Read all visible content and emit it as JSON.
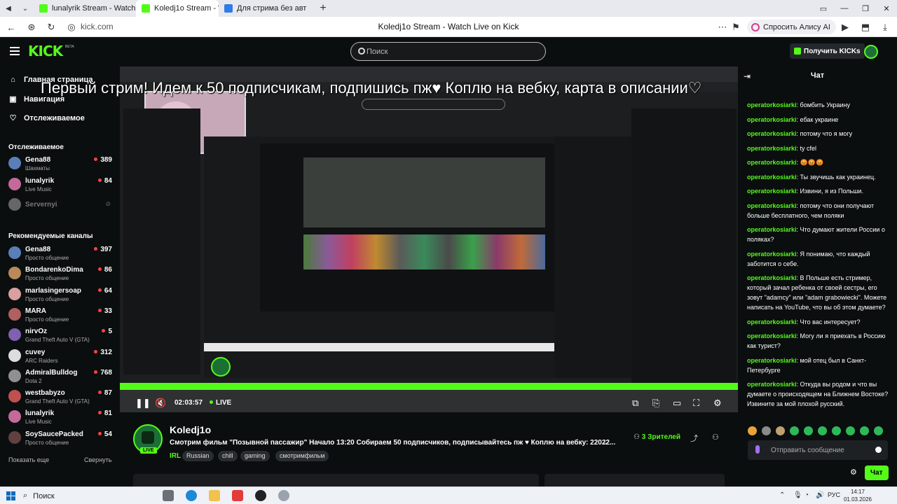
{
  "browser": {
    "tabs": [
      {
        "title": "lunalyrik Stream - Watch L",
        "active": false
      },
      {
        "title": "Koledj1o Stream - Watc",
        "active": true
      },
      {
        "title": "Для стрима без авт",
        "active": false
      }
    ],
    "url": "kick.com",
    "page_title": "Koledj1o Stream - Watch Live on Kick",
    "alice_label": "Спросить Алису AI"
  },
  "header": {
    "logo": "KICK",
    "beta": "BETA",
    "search_placeholder": "Поиск",
    "get_kicks_label": "Получить KICKs"
  },
  "sidebar": {
    "nav": [
      {
        "label": "Главная страница",
        "icon": "home-icon"
      },
      {
        "label": "Навигация",
        "icon": "compass-icon"
      },
      {
        "label": "Отслеживаемое",
        "icon": "heart-icon"
      }
    ],
    "following_header": "Отслеживаемое",
    "following": [
      {
        "name": "Gena88",
        "sub": "Шахматы",
        "viewers": "389",
        "color": "#5a7fb8"
      },
      {
        "name": "lunalyrik",
        "sub": "Live Music",
        "viewers": "84",
        "color": "#c46a9a"
      },
      {
        "name": "Servernyi",
        "sub": "",
        "viewers": "",
        "color": "#666666",
        "offline": true
      }
    ],
    "recommended_header": "Рекомендуемые каналы",
    "recommended": [
      {
        "name": "Gena88",
        "sub": "Просто общение",
        "viewers": "397",
        "color": "#5a7fb8"
      },
      {
        "name": "BondarenkoDima",
        "sub": "Просто общение",
        "viewers": "86",
        "color": "#b88a5a"
      },
      {
        "name": "marlasingersoap",
        "sub": "Просто общение",
        "viewers": "64",
        "color": "#d8a0a0"
      },
      {
        "name": "MARA",
        "sub": "Просто общение",
        "viewers": "33",
        "color": "#b06060"
      },
      {
        "name": "nirvOz",
        "sub": "Grand Theft Auto V (GTA)",
        "viewers": "5",
        "color": "#8060b0"
      },
      {
        "name": "cuvey",
        "sub": "ARC Raiders",
        "viewers": "312",
        "color": "#dddddd"
      },
      {
        "name": "AdmiralBulldog",
        "sub": "Dota 2",
        "viewers": "768",
        "color": "#909090"
      },
      {
        "name": "westbabyzo",
        "sub": "Grand Theft Auto V (GTA)",
        "viewers": "87",
        "color": "#c05050"
      },
      {
        "name": "lunalyrik",
        "sub": "Live Music",
        "viewers": "81",
        "color": "#c46a9a"
      },
      {
        "name": "SoySaucePacked",
        "sub": "Просто общение",
        "viewers": "54",
        "color": "#604040"
      }
    ],
    "show_more": "Показать еще",
    "collapse": "Свернуть"
  },
  "player": {
    "overlay_text": "Первый стрим! Идем к 50 подписчикам, подпишись пж♥ Коплю на вебку, карта в описании♡",
    "time": "02:03:57",
    "live_label": "LIVE"
  },
  "stream": {
    "channel": "Koledj1o",
    "live_badge": "LIVE",
    "title": "Смотрим фильм \"Позывной пассажир\" Начало 13:20 Собираем 50 подписчиков, подписывайтесь пж ♥ Коплю на вебку: 22022...",
    "category": "IRL",
    "tags": [
      "Russian",
      "chill",
      "gaming",
      "смотримфильм"
    ],
    "viewers_count": "3",
    "viewers_label": "Зрителей"
  },
  "chat": {
    "title": "Чат",
    "messages": [
      {
        "user": "operatorkosiarki",
        "text": "бомбить Украину"
      },
      {
        "user": "operatorkosiarki",
        "text": "ебак украине"
      },
      {
        "user": "operatorkosiarki",
        "text": "потому что я могу"
      },
      {
        "user": "operatorkosiarki",
        "text": "ty cfel"
      },
      {
        "user": "operatorkosiarki",
        "text": "😡😡😡"
      },
      {
        "user": "operatorkosiarki",
        "text": "Ты звучишь как украинец."
      },
      {
        "user": "operatorkosiarki",
        "text": "Извини, я из Польши."
      },
      {
        "user": "operatorkosiarki",
        "text": "потому что они получают больше бесплатного, чем поляки"
      },
      {
        "user": "operatorkosiarki",
        "text": "Что думают жители России о поляках?"
      },
      {
        "user": "operatorkosiarki",
        "text": "Я понимаю, что каждый заботится о себе."
      },
      {
        "user": "operatorkosiarki",
        "text": "В Польше есть стример, который зачал ребенка от своей сестры, его зовут \"adamcy\" или \"adam grabowiecki\". Можете написать на YouTube, что вы об этом думаете?"
      },
      {
        "user": "operatorkosiarki",
        "text": "Что вас интересует?"
      },
      {
        "user": "operatorkosiarki",
        "text": "Могу ли я приехать в Россию как турист?"
      },
      {
        "user": "operatorkosiarki",
        "text": "мой отец был в Санкт-Петербурге"
      },
      {
        "user": "operatorkosiarki",
        "text": "Откуда вы родом и что вы думаете о происходящем на Ближнем Востоке? Извините за мой плохой русский."
      }
    ],
    "input_placeholder": "Отправить сообщение",
    "send_label": "Чат"
  },
  "taskbar": {
    "search_label": "Поиск",
    "lang": "РУС",
    "time": "14:17",
    "date": "01.03.2026"
  }
}
